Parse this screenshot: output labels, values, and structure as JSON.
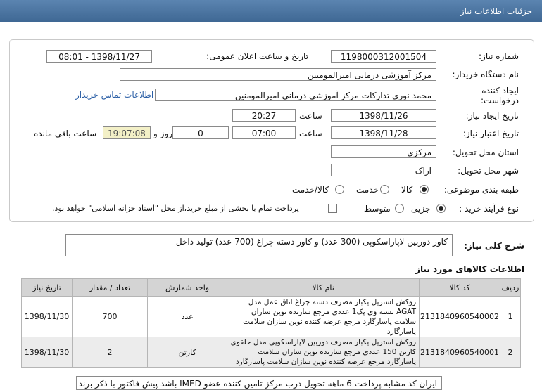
{
  "header": {
    "title": "جزئیات اطلاعات نیاز"
  },
  "form": {
    "need_number_label": "شماره نیاز:",
    "need_number": "1198000312001504",
    "announce_label": "تاریخ و ساعت اعلان عمومی:",
    "announce_value": "1398/11/27 - 08:01",
    "buyer_label": "نام دستگاه خریدار:",
    "buyer_value": "مرکز آموزشی درمانی امیرالمومنین",
    "creator_label_1": "ایجاد کننده",
    "creator_label_2": "درخواست:",
    "creator_value": "محمد نوری تدارکات مرکز آموزشی درمانی امیرالمومنین",
    "contact_link": "اطلاعات تماس خریدار",
    "created_date_label": "تاریخ ایجاد نیاز:",
    "created_date": "1398/11/26",
    "time_label": "ساعت",
    "created_time": "20:27",
    "valid_date_label": "تاریخ اعتبار نیاز:",
    "valid_date": "1398/11/28",
    "valid_time": "07:00",
    "days_value": "0",
    "days_label": "روز و",
    "remaining_value": "19:07:08",
    "remaining_label": "ساعت باقی مانده",
    "province_label": "استان محل تحویل:",
    "province_value": "مرکزی",
    "city_label": "شهر محل تحویل:",
    "city_value": "اراک",
    "category_label": "طبقه بندی موضوعی:",
    "category_options": [
      "کالا",
      "خدمت",
      "کالا/خدمت"
    ],
    "process_label": "نوع فرآیند خرید :",
    "process_options": [
      "جزیی",
      "متوسط"
    ],
    "payment_text": "پرداخت تمام یا بخشی از مبلغ خرید،از محل \"اسناد خزانه اسلامی\" خواهد بود."
  },
  "description": {
    "label": "شرح کلی نیاز:",
    "value": "کاور دوربین لاپاراسکوپی (300 عدد) و کاور دسته چراغ (700 عدد) تولید داخل"
  },
  "items_section": {
    "title": "اطلاعات کالاهای مورد نیاز",
    "headers": [
      "ردیف",
      "کد کالا",
      "نام کالا",
      "واحد شمارش",
      "تعداد / مقدار",
      "تاریخ نیاز"
    ],
    "rows": [
      {
        "idx": "1",
        "code": "2131840960540002",
        "name": "روکش استریل یکبار مصرف دسته چراغ اتاق عمل مدل AGAT بسته وی پک1 عددی مرجع سازنده نوین سازان سلامت پاسارگارد مرجع عرضه کننده نوین سازان سلامت پاسارگارد",
        "unit": "عدد",
        "qty": "700",
        "date": "1398/11/30"
      },
      {
        "idx": "2",
        "code": "2131840960540001",
        "name": "روکش استریل یکبار مصرف دوربین لاپاراسکوپی مدل حلقوی کارتن 150 عددی مرجع سازنده نوین سازان سلامت پاسارگارد مرجع عرضه کننده نوین سازان سلامت پاسارگارد",
        "unit": "کارتن",
        "qty": "2",
        "date": "1398/11/30"
      }
    ]
  },
  "bottom_note": "ایران کد مشابه پرداخت 6 ماهه تحویل درب مرکز تامین کننده عضو IMED باشد پیش فاکتور با ذکر برند و"
}
